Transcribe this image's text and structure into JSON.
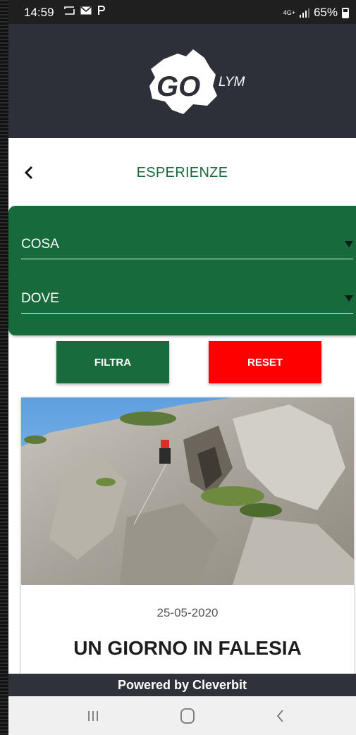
{
  "status_bar": {
    "time": "14:59",
    "network": "4G+",
    "battery": "65%"
  },
  "header": {
    "logo_text_main": "GO",
    "logo_text_suffix": "LYM",
    "background": "#2d3038"
  },
  "titlebar": {
    "title": "ESPERIENZE",
    "title_color": "#1a6b3c"
  },
  "filters": {
    "cosa": {
      "value": "COSA"
    },
    "dove": {
      "value": "DOVE"
    },
    "panel_color": "#176a3b"
  },
  "buttons": {
    "filtra_label": "FILTRA",
    "reset_label": "RESET",
    "filtra_color": "#186b3c",
    "reset_color": "#ff0000"
  },
  "cards": [
    {
      "date": "25-05-2020",
      "title": "UN GIORNO IN FALESIA"
    }
  ],
  "footer": {
    "powered_by": "Powered by Cleverbit"
  },
  "icons": {
    "back": "chevron-left-icon",
    "nav_recents": "recents-icon",
    "nav_home": "home-icon",
    "nav_back": "back-icon"
  }
}
